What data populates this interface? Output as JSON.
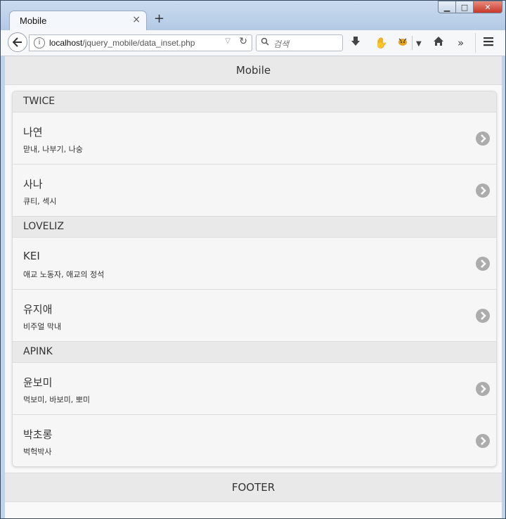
{
  "browser": {
    "tab_title": "Mobile",
    "tab_close": "×",
    "new_tab": "+",
    "url_host": "localhost",
    "url_path": "/jquery_mobile/data_inset.php",
    "search_placeholder": "검색"
  },
  "page": {
    "header_title": "Mobile",
    "footer_title": "FOOTER"
  },
  "groups": [
    {
      "name": "TWICE",
      "items": [
        {
          "title": "나연",
          "desc": "맏내, 나부기, 나숭"
        },
        {
          "title": "사나",
          "desc": "큐티, 섹시"
        }
      ]
    },
    {
      "name": "LOVELIZ",
      "items": [
        {
          "title": "KEI",
          "desc": "애교 노동자, 애교의 정석"
        },
        {
          "title": "유지애",
          "desc": "비주얼 막내"
        }
      ]
    },
    {
      "name": "APINK",
      "items": [
        {
          "title": "윤보미",
          "desc": "먹보미, 바보미, 뽀미"
        },
        {
          "title": "박초롱",
          "desc": "벅헉박사"
        }
      ]
    }
  ],
  "colors": {
    "bar_bg": "#e9e9e9",
    "list_bg": "#f6f6f6",
    "arrow_bg": "#acacac"
  }
}
